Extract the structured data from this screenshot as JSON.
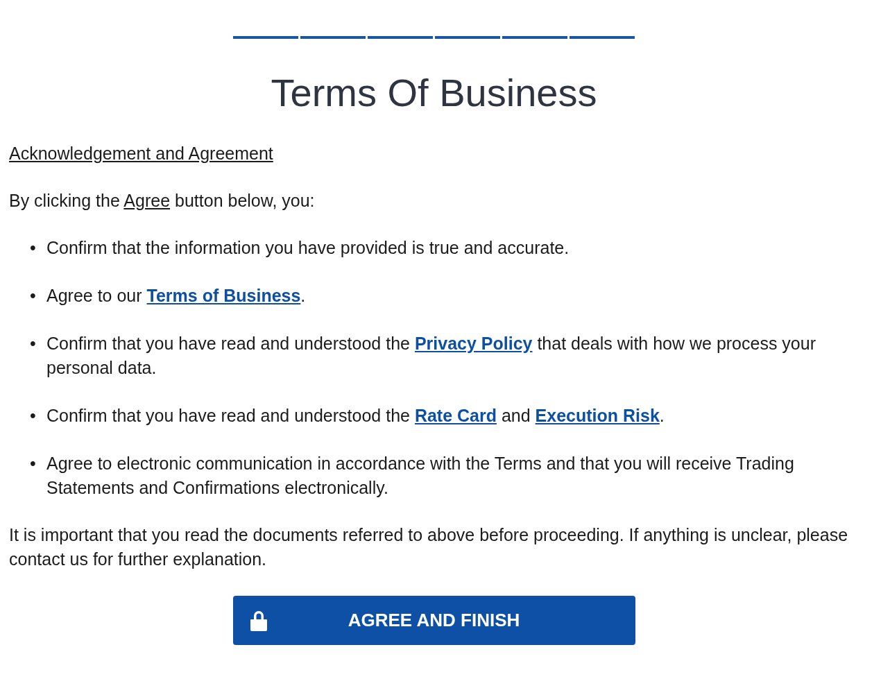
{
  "progress": {
    "steps": [
      {
        "completed": true
      },
      {
        "completed": true
      },
      {
        "completed": true
      },
      {
        "completed": true
      },
      {
        "completed": true
      },
      {
        "completed": true
      }
    ]
  },
  "title": "Terms Of Business",
  "section_heading": "Acknowledgement and Agreement",
  "intro": [
    {
      "kind": "text",
      "text": "By clicking the "
    },
    {
      "kind": "underline",
      "text": "Agree"
    },
    {
      "kind": "text",
      "text": " button below, you:"
    }
  ],
  "items": [
    {
      "marker": "•",
      "parts": [
        {
          "kind": "text",
          "text": "Confirm that the information you have provided is true and accurate."
        }
      ]
    },
    {
      "marker": "•",
      "parts": [
        {
          "kind": "text",
          "text": "Agree to our "
        },
        {
          "kind": "link",
          "text": "Terms of Business"
        },
        {
          "kind": "text",
          "text": "."
        }
      ]
    },
    {
      "marker": "•",
      "parts": [
        {
          "kind": "text",
          "text": "Confirm that you have read and understood the "
        },
        {
          "kind": "link",
          "text": "Privacy Policy"
        },
        {
          "kind": "text",
          "text": " that deals with how we process your personal data."
        }
      ]
    },
    {
      "marker": "•",
      "parts": [
        {
          "kind": "text",
          "text": "Confirm that you have read and understood the "
        },
        {
          "kind": "link",
          "text": "Rate Card"
        },
        {
          "kind": "text",
          "text": " and "
        },
        {
          "kind": "link",
          "text": "Execution Risk"
        },
        {
          "kind": "text",
          "text": "."
        }
      ]
    },
    {
      "marker": "•",
      "parts": [
        {
          "kind": "text",
          "text": "Agree to electronic communication in accordance with the Terms and that you will receive Trading Statements and Confirmations electronically."
        }
      ]
    }
  ],
  "note": "It is important that you read the documents referred to above before proceeding. If anything is unclear, please contact us for further explanation.",
  "button": {
    "label": "AGREE AND FINISH"
  }
}
